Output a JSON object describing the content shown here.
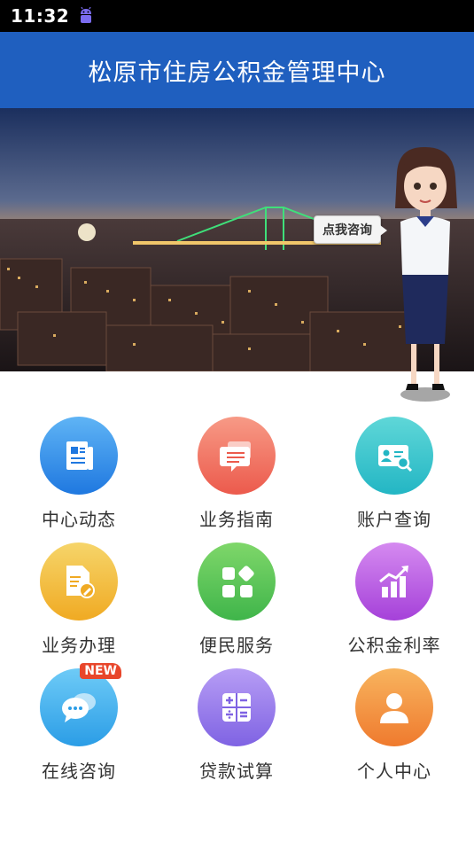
{
  "status_bar": {
    "time": "11:32",
    "icon": "android-icon"
  },
  "header": {
    "title": "松原市住房公积金管理中心"
  },
  "banner": {
    "consult_label": "点我咨询"
  },
  "menu": [
    {
      "label": "中心动态",
      "icon": "news-icon",
      "color_top": "#5fb4f5",
      "color_bottom": "#1f78e0"
    },
    {
      "label": "业务指南",
      "icon": "guide-icon",
      "color_top": "#f79a86",
      "color_bottom": "#ec5a4c"
    },
    {
      "label": "账户查询",
      "icon": "account-search-icon",
      "color_top": "#5fd7d8",
      "color_bottom": "#23b6c4"
    },
    {
      "label": "业务办理",
      "icon": "document-edit-icon",
      "color_top": "#f6d56a",
      "color_bottom": "#f0aa23"
    },
    {
      "label": "便民服务",
      "icon": "apps-grid-icon",
      "color_top": "#7fd76a",
      "color_bottom": "#3fb54a"
    },
    {
      "label": "公积金利率",
      "icon": "rate-chart-icon",
      "color_top": "#d58af0",
      "color_bottom": "#a541d9"
    },
    {
      "label": "在线咨询",
      "icon": "chat-icon",
      "color_top": "#6ecbf7",
      "color_bottom": "#2b9de6",
      "badge": "NEW"
    },
    {
      "label": "贷款试算",
      "icon": "calculator-icon",
      "color_top": "#b79df5",
      "color_bottom": "#7f63e3"
    },
    {
      "label": "个人中心",
      "icon": "user-icon",
      "color_top": "#f8b45e",
      "color_bottom": "#ef7a2e"
    }
  ]
}
